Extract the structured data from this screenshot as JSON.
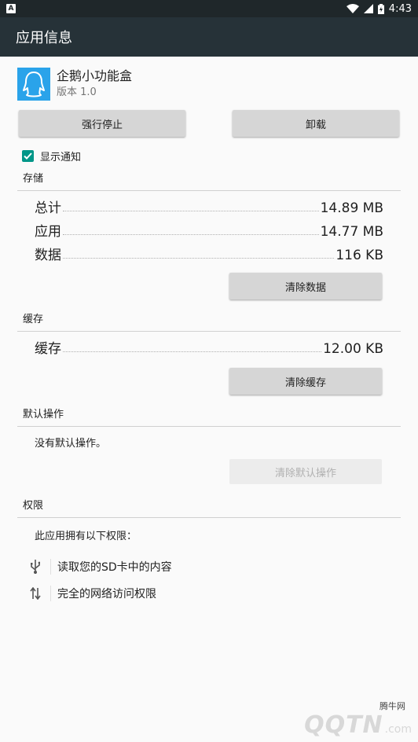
{
  "status_bar": {
    "time": "4:43",
    "notif_glyph": "A"
  },
  "app_bar": {
    "title": "应用信息"
  },
  "app": {
    "name": "企鹅小功能盒",
    "version": "版本 1.0",
    "icon": "penguin-icon",
    "icon_color": "#2aa3ea"
  },
  "actions": {
    "force_stop": "强行停止",
    "uninstall": "卸载"
  },
  "notifications": {
    "label": "显示通知",
    "checked": true,
    "accent": "#009688"
  },
  "storage": {
    "title": "存储",
    "rows": [
      {
        "label": "总计",
        "value": "14.89 MB"
      },
      {
        "label": "应用",
        "value": "14.77 MB"
      },
      {
        "label": "数据",
        "value": "116 KB"
      }
    ],
    "clear_button": "清除数据"
  },
  "cache": {
    "title": "缓存",
    "row": {
      "label": "缓存",
      "value": "12.00 KB"
    },
    "clear_button": "清除缓存"
  },
  "defaults": {
    "title": "默认操作",
    "text": "没有默认操作。",
    "clear_button": "清除默认操作"
  },
  "permissions": {
    "title": "权限",
    "intro": "此应用拥有以下权限：",
    "items": [
      {
        "icon": "usb-icon",
        "label": "读取您的SD卡中的内容"
      },
      {
        "icon": "network-arrows-icon",
        "label": "完全的网络访问权限"
      }
    ]
  },
  "watermark": {
    "small": "腾牛网",
    "big": "QQTN",
    "suffix": ".com"
  }
}
